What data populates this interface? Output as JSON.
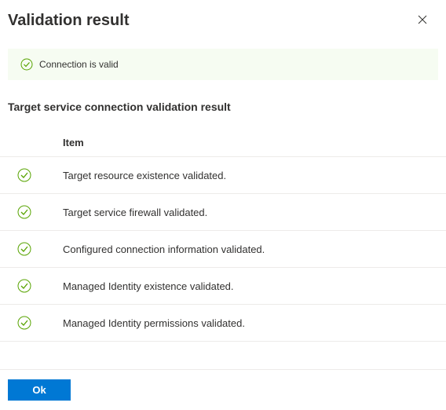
{
  "header": {
    "title": "Validation result"
  },
  "banner": {
    "message": "Connection is valid"
  },
  "section": {
    "title": "Target service connection validation result"
  },
  "table": {
    "header": "Item",
    "rows": [
      {
        "item": "Target resource existence validated."
      },
      {
        "item": "Target service firewall validated."
      },
      {
        "item": "Configured connection information validated."
      },
      {
        "item": "Managed Identity existence validated."
      },
      {
        "item": "Managed Identity permissions validated."
      }
    ]
  },
  "footer": {
    "ok_label": "Ok"
  }
}
